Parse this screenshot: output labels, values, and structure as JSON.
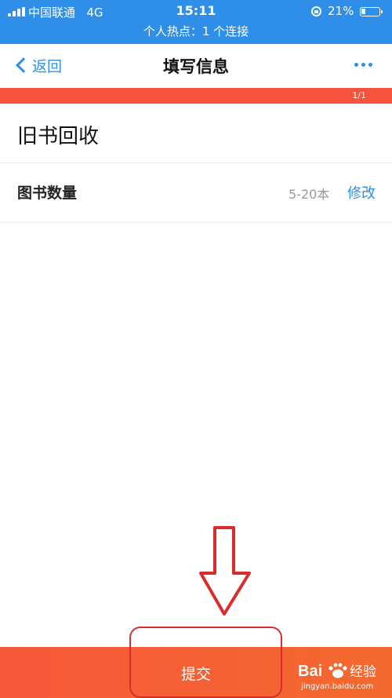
{
  "status_bar": {
    "carrier": "中国联通",
    "network": "4G",
    "time": "15:11",
    "battery": "21%",
    "hotspot": "个人热点：1 个连接",
    "icons": [
      "signal-icon",
      "rotation-lock-icon",
      "battery-icon"
    ]
  },
  "nav": {
    "back_label": "返回",
    "title": "填写信息",
    "more_icon": "more-icon"
  },
  "progress": {
    "label": "1/1",
    "fraction": 1.0
  },
  "form": {
    "title": "旧书回收",
    "rows": [
      {
        "label": "图书数量",
        "value": "5-20本",
        "action": "修改"
      }
    ]
  },
  "bottom_bar": {
    "submit_label": "提交"
  },
  "watermark": {
    "brand": "Bai百经验",
    "url": "jingyan.baidu.com"
  },
  "colors": {
    "primary_blue": "#2f8fe8",
    "accent_red": "#f5533d",
    "annotation_red": "#d92d2d"
  }
}
